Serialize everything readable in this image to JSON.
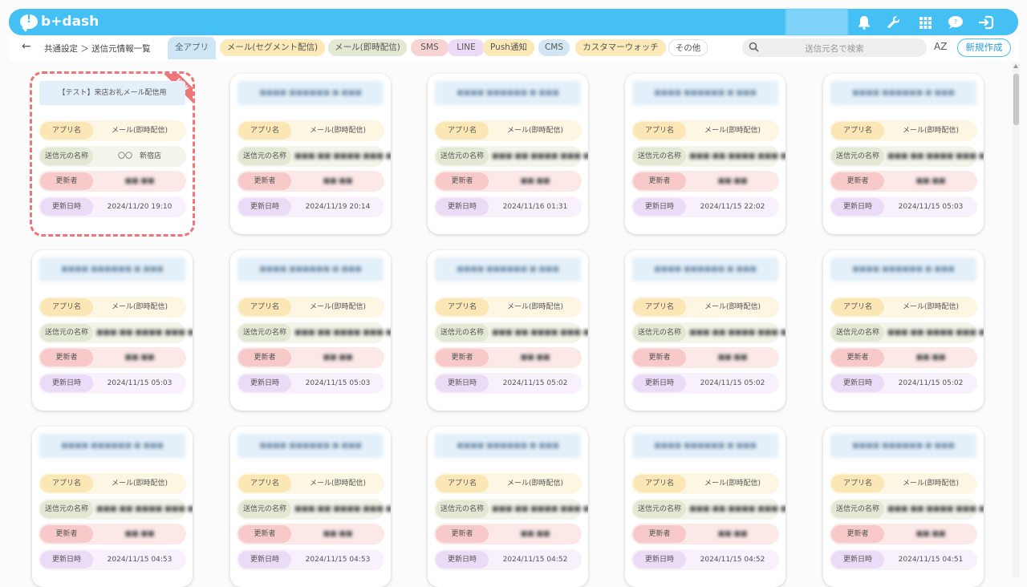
{
  "header": {
    "logo_text": "b+dash",
    "icons": [
      "bell-icon",
      "wrench-icon",
      "grid-icon",
      "chat-bubble-icon",
      "logout-icon"
    ]
  },
  "toolbar": {
    "back_icon": "←",
    "breadcrumb": "共通設定 ＞ 送信元情報一覧",
    "tabs": [
      {
        "label": "全アプリ",
        "color": "#cfe6f4",
        "active": true
      },
      {
        "label": "メール(セグメント配信)",
        "color": "#fbe9b8"
      },
      {
        "label": "メール(即時配信)",
        "color": "#e3ead3"
      },
      {
        "label": "SMS",
        "color": "#f8d3d3"
      },
      {
        "label": "LINE",
        "color": "#ecdbf6"
      },
      {
        "label": "Push通知",
        "color": "#fbe9b8"
      },
      {
        "label": "CMS",
        "color": "#d2e6f3"
      },
      {
        "label": "カスタマーウォッチ",
        "color": "#fbe9b8"
      },
      {
        "label": "その他",
        "color": "#ffffff"
      }
    ],
    "search_placeholder": "送信元名で検索",
    "sort_label": "AZ",
    "new_button": "新規作成"
  },
  "cards": {
    "labels": {
      "app": "アプリ名",
      "sender": "送信元の名称",
      "updater": "更新者",
      "updated": "更新日時"
    },
    "new_badge": "NEW",
    "items": [
      {
        "title": "【テスト】来店お礼メール配信用",
        "app": "メール(即時配信)",
        "sender": "〇〇　新宿店",
        "updater": "",
        "updated": "2024/11/20 19:10",
        "is_new": true
      },
      {
        "title": "",
        "app": "メール(即時配信)",
        "sender": "",
        "updater": "",
        "updated": "2024/11/19 20:14"
      },
      {
        "title": "",
        "app": "メール(即時配信)",
        "sender": "",
        "updater": "",
        "updated": "2024/11/16 01:31"
      },
      {
        "title": "",
        "app": "メール(即時配信)",
        "sender": "",
        "updater": "",
        "updated": "2024/11/15 22:02"
      },
      {
        "title": "",
        "app": "メール(即時配信)",
        "sender": "",
        "updater": "",
        "updated": "2024/11/15 05:03"
      },
      {
        "title": "",
        "app": "メール(即時配信)",
        "sender": "",
        "updater": "",
        "updated": "2024/11/15 05:03"
      },
      {
        "title": "",
        "app": "メール(即時配信)",
        "sender": "",
        "updater": "",
        "updated": "2024/11/15 05:03"
      },
      {
        "title": "",
        "app": "メール(即時配信)",
        "sender": "",
        "updater": "",
        "updated": "2024/11/15 05:02"
      },
      {
        "title": "",
        "app": "メール(即時配信)",
        "sender": "",
        "updater": "",
        "updated": "2024/11/15 05:02"
      },
      {
        "title": "",
        "app": "メール(即時配信)",
        "sender": "",
        "updater": "",
        "updated": "2024/11/15 05:02"
      },
      {
        "title": "",
        "app": "メール(即時配信)",
        "sender": "",
        "updater": "",
        "updated": "2024/11/15 04:53"
      },
      {
        "title": "",
        "app": "メール(即時配信)",
        "sender": "",
        "updater": "",
        "updated": "2024/11/15 04:53"
      },
      {
        "title": "",
        "app": "メール(即時配信)",
        "sender": "",
        "updater": "",
        "updated": "2024/11/15 04:52"
      },
      {
        "title": "",
        "app": "メール(即時配信)",
        "sender": "",
        "updater": "",
        "updated": "2024/11/15 04:52"
      },
      {
        "title": "",
        "app": "メール(即時配信)",
        "sender": "",
        "updater": "",
        "updated": "2024/11/15 04:51"
      }
    ]
  }
}
